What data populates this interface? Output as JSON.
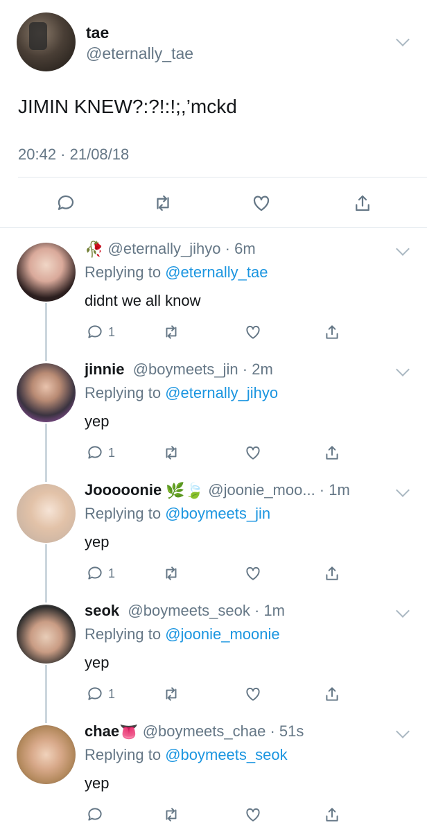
{
  "main_tweet": {
    "name": "tae",
    "handle": "@eternally_tae",
    "text": "JIMIN KNEW?:?!:!;,’mckd",
    "timestamp": "20:42 · 21/08/18"
  },
  "replies": [
    {
      "name": "",
      "emoji": "🥀",
      "handle": "@eternally_jihyo",
      "time": "6m",
      "replying_label": "Replying to ",
      "replying_to": "@eternally_tae",
      "text": "didnt we all know",
      "reply_count": "1",
      "avatar_colors": [
        "#e8c9b8",
        "#3a2a2a"
      ]
    },
    {
      "name": "jinnie",
      "emoji": "",
      "handle": "@boymeets_jin",
      "time": "2m",
      "replying_label": "Replying to ",
      "replying_to": "@eternally_jihyo",
      "text": "yep",
      "reply_count": "1",
      "avatar_colors": [
        "#c060d0",
        "#3a3340"
      ]
    },
    {
      "name": "Jooooonie",
      "emoji": "🌿🍃",
      "handle": "@joonie_moo...",
      "time": "1m",
      "replying_label": "Replying to ",
      "replying_to": "@boymeets_jin",
      "text": "yep",
      "reply_count": "1",
      "avatar_colors": [
        "#f3e3d6",
        "#caa88f"
      ]
    },
    {
      "name": "seok",
      "emoji": "",
      "handle": "@boymeets_seok",
      "time": "1m",
      "replying_label": "Replying to ",
      "replying_to": "@joonie_moonie",
      "text": "yep",
      "reply_count": "1",
      "avatar_colors": [
        "#d9c4b3",
        "#2b2b2b"
      ]
    },
    {
      "name": "chae",
      "emoji": "👅",
      "handle": "@boymeets_chae",
      "time": "51s",
      "replying_label": "Replying to ",
      "replying_to": "@boymeets_seok",
      "text": "yep",
      "reply_count": "",
      "avatar_colors": [
        "#e6cbb0",
        "#8a6a4a"
      ]
    }
  ],
  "icons": [
    "reply-icon",
    "retweet-icon",
    "like-icon",
    "share-icon",
    "chevron-down-icon"
  ],
  "colors": {
    "link": "#1b95e0",
    "muted": "#657786",
    "divider": "#e1e8ed",
    "icon": "#657786"
  }
}
